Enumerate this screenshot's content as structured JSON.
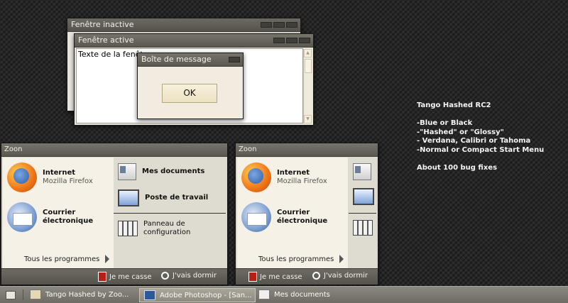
{
  "windows": {
    "inactive": {
      "title": "Fenêtre inactive"
    },
    "active": {
      "title": "Fenêtre active",
      "body_text": "Texte de la fenêtre"
    },
    "message": {
      "title": "Boîte de message",
      "ok_label": "OK"
    }
  },
  "start_menus": [
    {
      "title": "Zoon",
      "internet": {
        "label": "Internet",
        "sub": "Mozilla Firefox"
      },
      "mail": {
        "label": "Courrier",
        "label2": "électronique"
      },
      "all_programs": "Tous les programmes",
      "right_items": [
        "Mes documents",
        "Poste de travail",
        "Panneau de",
        "configuration"
      ],
      "logoff": "Je me casse",
      "shutdown": "J'vais dormir"
    },
    {
      "title": "Zoon",
      "internet": {
        "label": "Internet",
        "sub": "Mozilla Firefox"
      },
      "mail": {
        "label": "Courrier",
        "label2": "électronique"
      },
      "all_programs": "Tous les programmes",
      "logoff": "Je me casse",
      "shutdown": "J'vais dormir"
    }
  ],
  "info": [
    "Tango Hashed RC2",
    "",
    "-Blue or Black",
    "-\"Hashed\" or \"Glossy\"",
    "- Verdana, Calibri or Tahoma",
    "-Normal or Compact Start Menu",
    "",
    "About 100 bug fixes"
  ],
  "taskbar": {
    "tasks": [
      "Tango Hashed by Zoo...",
      "Adobe Photoshop - [San...",
      "Mes documents"
    ]
  },
  "icons": {
    "start": "home-icon",
    "firefox": "firefox-icon",
    "mail": "thunderbird-icon",
    "documents": "documents-icon",
    "computer": "computer-icon",
    "control_panel": "control-panel-icon"
  }
}
